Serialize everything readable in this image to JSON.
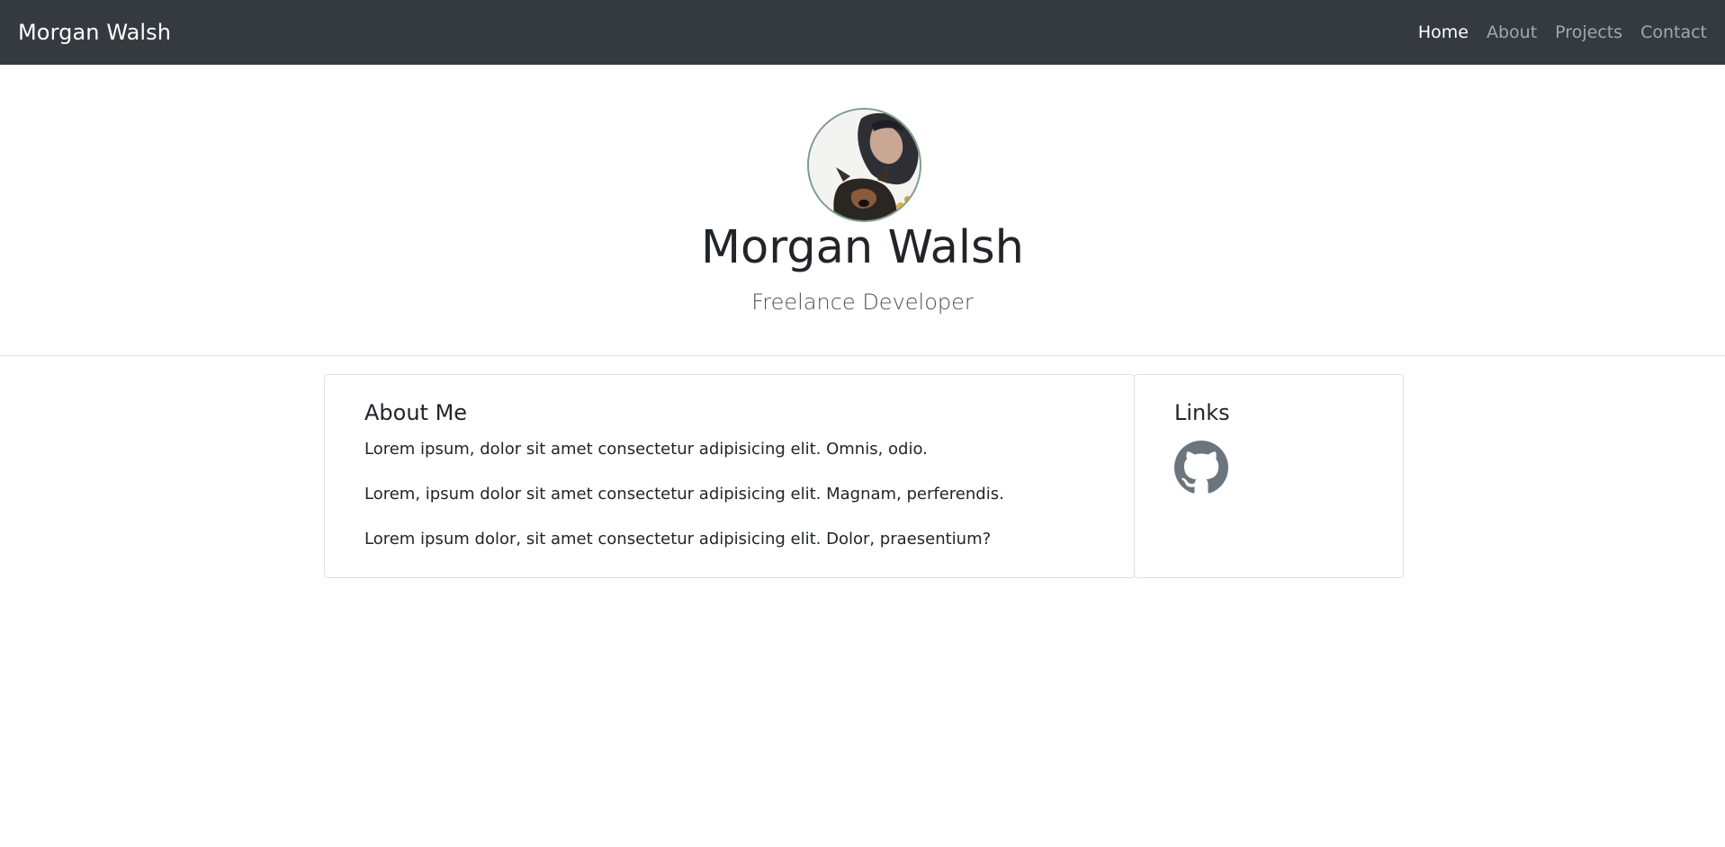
{
  "navbar": {
    "brand": "Morgan Walsh",
    "links": [
      {
        "label": "Home",
        "active": true
      },
      {
        "label": "About",
        "active": false
      },
      {
        "label": "Projects",
        "active": false
      },
      {
        "label": "Contact",
        "active": false
      }
    ]
  },
  "hero": {
    "name": "Morgan Walsh",
    "subtitle": "Freelance Developer"
  },
  "about": {
    "title": "About Me",
    "paragraphs": [
      "Lorem ipsum, dolor sit amet consectetur adipisicing elit. Omnis, odio.",
      "Lorem, ipsum dolor sit amet consectetur adipisicing elit. Magnam, perferendis.",
      "Lorem ipsum dolor, sit amet consectetur adipisicing elit. Dolor, praesentium?"
    ]
  },
  "links": {
    "title": "Links",
    "items": [
      {
        "icon": "github-icon"
      }
    ]
  },
  "colors": {
    "navbar_bg": "#343a40",
    "nav_active": "#ffffff",
    "nav_inactive": "#9a9da0",
    "icon": "#6c757d"
  }
}
